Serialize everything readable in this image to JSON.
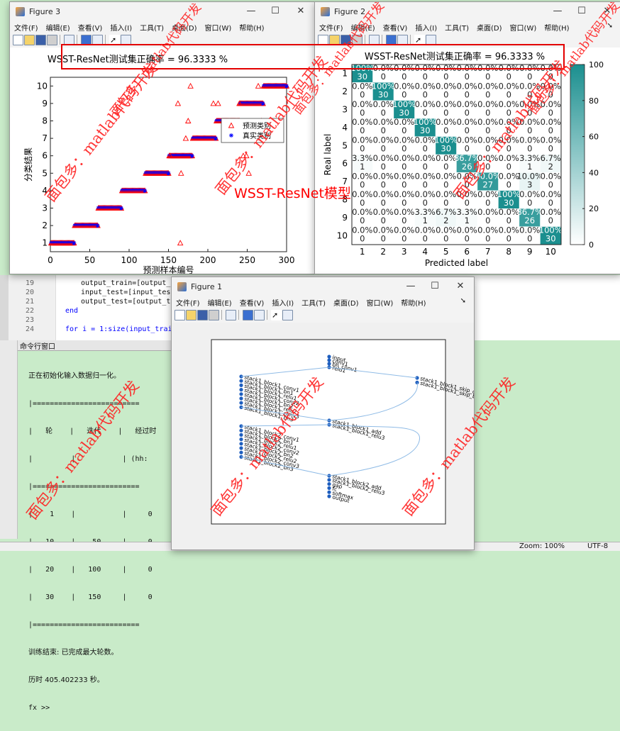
{
  "colors": {
    "desktop_green": "#c9ebc9",
    "annotation_red": "#e30000",
    "matrix_teal": "#1b8f8f",
    "watermark": "#ff2020"
  },
  "figure3": {
    "title": "Figure 3",
    "menu": [
      "文件(F)",
      "编辑(E)",
      "查看(V)",
      "插入(I)",
      "工具(T)",
      "桌面(D)",
      "窗口(W)",
      "帮助(H)"
    ],
    "icons": [
      "new-icon",
      "open-icon",
      "save-icon",
      "print-icon",
      "export-icon",
      "tile-icon",
      "insert-colorbar-icon",
      "pointer-icon",
      "data-cursor-icon"
    ]
  },
  "figure2": {
    "title": "Figure 2",
    "menu": [
      "文件(F)",
      "编辑(E)",
      "查看(V)",
      "插入(I)",
      "工具(T)",
      "桌面(D)",
      "窗口(W)",
      "帮助(H)"
    ]
  },
  "figure1": {
    "title": "Figure 1",
    "menu": [
      "文件(F)",
      "编辑(E)",
      "查看(V)",
      "插入(I)",
      "工具(T)",
      "桌面(D)",
      "窗口(W)",
      "帮助(H)"
    ],
    "nodes": {
      "input_group": [
        "input",
        "conv1",
        "bn_conv1",
        "relu1"
      ],
      "left_group_1": [
        "stack1_block1_conv1",
        "stack1_block1_bn1",
        "stack1_block1_relu1",
        "stack1_block1_conv2",
        "stack1_block1_bn2",
        "stack1_block1_relu2",
        "stack1_block1_conv3",
        "stack1_block1_bn3"
      ],
      "skip_group": [
        "stack1_block1_skip_c",
        "stack1_block1_skip_b"
      ],
      "add_group_1": [
        "stack1_block1_add",
        "stack1_block1_relu3"
      ],
      "left_group_2": [
        "stack1_block2_conv1",
        "stack1_block2_bn1",
        "stack1_block2_relu1",
        "stack1_block2_conv2",
        "stack1_block2_bn2",
        "stack1_block2_relu2",
        "stack1_block2_conv3",
        "stack1_block2_bn3"
      ],
      "output_group": [
        "stack1_block2_add",
        "stack1_block2_relu3",
        "gap",
        "fc",
        "softmax",
        "output"
      ]
    }
  },
  "editor": {
    "lines": [
      {
        "num": "19",
        "text": "output_train=[output_tr"
      },
      {
        "num": "20",
        "text": "input_test=[input_test;"
      },
      {
        "num": "21",
        "text": "output_test=[output_tes"
      },
      {
        "num": "22",
        "text": "end"
      },
      {
        "num": "23",
        "text": ""
      },
      {
        "num": "24",
        "text": "for i = 1:size(input_train,"
      }
    ]
  },
  "command_window": {
    "title": "命令行窗口",
    "init_line": "正在初始化输入数据归一化。",
    "table_border": "|=========================",
    "header_1": "|   轮    |   迭代    |   经过时",
    "header_2": "|         |           | (hh:",
    "rows": [
      "|    1    |           |     0",
      "|   10    |    50     |     0",
      "|   20    |   100     |     0",
      "|   30    |   150     |     0"
    ],
    "result_line": "训练结束: 已完成最大轮数。",
    "elapsed_line": "历时 405.402233 秒。",
    "prompt": "fx >>"
  },
  "statusbar": {
    "zoom": "Zoom: 100%",
    "encoding": "UTF-8"
  },
  "annotations": {
    "model_label": "WSST-ResNet模型"
  },
  "watermarks": [
    "面包多：matlab代码开发",
    "面包多：matlab代码开发",
    "面包多：matlab代码开发",
    "面包多：matlab代码开发",
    "面包多：matlab代码开发",
    "面包多：matlab代码开发",
    "面包多：matlab代码开发",
    "面包多：matlab代码开发",
    "面包多：matlab代码开发"
  ],
  "chart_data": [
    {
      "type": "scatter",
      "title": "WSST-ResNet测试集正确率 = 96.3333 %",
      "xlabel": "预测样本编号",
      "ylabel": "分类结果",
      "xlim": [
        0,
        300
      ],
      "ylim": [
        0.5,
        10.5
      ],
      "xticks": [
        0,
        50,
        100,
        150,
        200,
        250,
        300
      ],
      "yticks": [
        1,
        2,
        3,
        4,
        5,
        6,
        7,
        8,
        9,
        10
      ],
      "legend_position": "top-right",
      "series": [
        {
          "name": "预测类别",
          "marker": "triangle",
          "color": "#ff0000"
        },
        {
          "name": "真实类别",
          "marker": "star",
          "color": "#0000ff"
        }
      ],
      "true_class_segments": [
        {
          "class": 1,
          "x": [
            1,
            30
          ]
        },
        {
          "class": 2,
          "x": [
            31,
            60
          ]
        },
        {
          "class": 3,
          "x": [
            61,
            90
          ]
        },
        {
          "class": 4,
          "x": [
            91,
            120
          ]
        },
        {
          "class": 5,
          "x": [
            121,
            150
          ]
        },
        {
          "class": 6,
          "x": [
            151,
            180
          ]
        },
        {
          "class": 7,
          "x": [
            181,
            210
          ]
        },
        {
          "class": 8,
          "x": [
            211,
            240
          ]
        },
        {
          "class": 9,
          "x": [
            241,
            270
          ]
        },
        {
          "class": 10,
          "x": [
            271,
            300
          ]
        }
      ],
      "misclassified_points": [
        {
          "x": 165,
          "y": 1
        },
        {
          "x": 166,
          "y": 5
        },
        {
          "x": 172,
          "y": 7
        },
        {
          "x": 175,
          "y": 8
        },
        {
          "x": 178,
          "y": 10
        },
        {
          "x": 162,
          "y": 9
        },
        {
          "x": 152,
          "y": 6
        },
        {
          "x": 207,
          "y": 9
        },
        {
          "x": 213,
          "y": 9
        },
        {
          "x": 240,
          "y": 9
        },
        {
          "x": 245,
          "y": 6
        },
        {
          "x": 249,
          "y": 6
        },
        {
          "x": 252,
          "y": 5
        },
        {
          "x": 258,
          "y": 7
        },
        {
          "x": 264,
          "y": 10
        },
        {
          "x": 268,
          "y": 8
        }
      ]
    },
    {
      "type": "heatmap",
      "title": "WSST-ResNet测试集正确率 = 96.3333 %",
      "xlabel": "Predicted label",
      "ylabel": "Real label",
      "categories": [
        "1",
        "2",
        "3",
        "4",
        "5",
        "6",
        "7",
        "8",
        "9",
        "10"
      ],
      "colorbar_ticks": [
        0,
        20,
        40,
        60,
        80,
        100
      ],
      "counts": [
        [
          30,
          0,
          0,
          0,
          0,
          0,
          0,
          0,
          0,
          0
        ],
        [
          0,
          30,
          0,
          0,
          0,
          0,
          0,
          0,
          0,
          0
        ],
        [
          0,
          0,
          30,
          0,
          0,
          0,
          0,
          0,
          0,
          0
        ],
        [
          0,
          0,
          0,
          30,
          0,
          0,
          0,
          0,
          0,
          0
        ],
        [
          0,
          0,
          0,
          0,
          30,
          0,
          0,
          0,
          0,
          0
        ],
        [
          1,
          0,
          0,
          0,
          0,
          26,
          0,
          0,
          1,
          2
        ],
        [
          0,
          0,
          0,
          0,
          0,
          0,
          27,
          0,
          3,
          0
        ],
        [
          0,
          0,
          0,
          0,
          0,
          0,
          0,
          30,
          0,
          0
        ],
        [
          0,
          0,
          0,
          1,
          2,
          1,
          0,
          0,
          26,
          0
        ],
        [
          0,
          0,
          0,
          0,
          0,
          0,
          0,
          0,
          0,
          30
        ]
      ],
      "percents": [
        [
          "100",
          "0.0",
          "0.0",
          "0.0",
          "0.0",
          "0.0",
          "0.0",
          "0.0",
          "0.0",
          "0.0"
        ],
        [
          "0.0",
          "100",
          "0.0",
          "0.0",
          "0.0",
          "0.0",
          "0.0",
          "0.0",
          "0.0",
          "0.0"
        ],
        [
          "0.0",
          "0.0",
          "100",
          "0.0",
          "0.0",
          "0.0",
          "0.0",
          "0.0",
          "0.0",
          "0.0"
        ],
        [
          "0.0",
          "0.0",
          "0.0",
          "100",
          "0.0",
          "0.0",
          "0.0",
          "0.0",
          "0.0",
          "0.0"
        ],
        [
          "0.0",
          "0.0",
          "0.0",
          "0.0",
          "100",
          "0.0",
          "0.0",
          "0.0",
          "0.0",
          "0.0"
        ],
        [
          "3.3",
          "0.0",
          "0.0",
          "0.0",
          "0.0",
          "86.7",
          "0.0",
          "0.0",
          "3.3",
          "6.7"
        ],
        [
          "0.0",
          "0.0",
          "0.0",
          "0.0",
          "0.0",
          "0.0",
          "90.0",
          "0.0",
          "10.0",
          "0.0"
        ],
        [
          "0.0",
          "0.0",
          "0.0",
          "0.0",
          "0.0",
          "0.0",
          "0.0",
          "100",
          "0.0",
          "0.0"
        ],
        [
          "0.0",
          "0.0",
          "0.0",
          "3.3",
          "6.7",
          "3.3",
          "0.0",
          "0.0",
          "86.7",
          "0.0"
        ],
        [
          "0.0",
          "0.0",
          "0.0",
          "0.0",
          "0.0",
          "0.0",
          "0.0",
          "0.0",
          "0.0",
          "100"
        ]
      ]
    }
  ]
}
